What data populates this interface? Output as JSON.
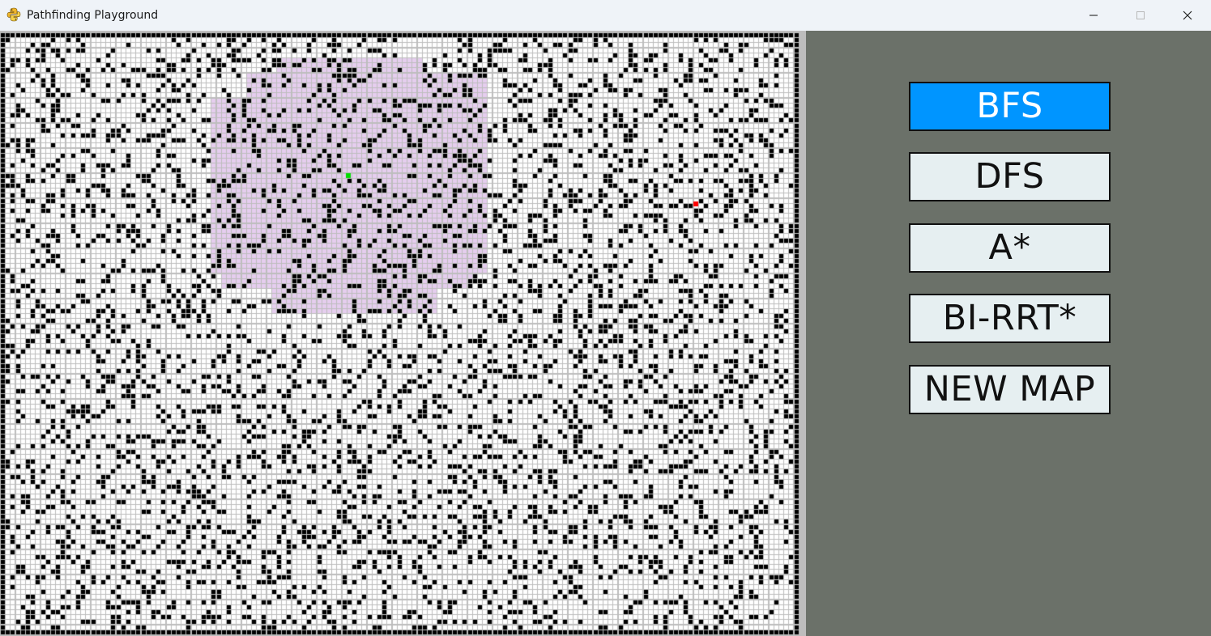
{
  "window": {
    "title": "Pathfinding Playground",
    "app_icon": "python-icon",
    "controls": [
      "minimize-icon",
      "maximize-icon",
      "close-icon"
    ]
  },
  "grid": {
    "visited_region_color": "#e6cdef",
    "start_color": "#00dd00",
    "goal_color": "#ff0000",
    "wall_color": "#000000",
    "empty_color": "#ffffff",
    "line_color": "#bdbdbd"
  },
  "panel": {
    "background": "#6b7169",
    "buttons": [
      {
        "label": "BFS",
        "active": true
      },
      {
        "label": "DFS",
        "active": false
      },
      {
        "label": "A*",
        "active": false
      },
      {
        "label": "BI-RRT*",
        "active": false
      },
      {
        "label": "NEW MAP",
        "active": false
      }
    ],
    "active_color": "#0095ff",
    "inactive_color": "#e6eff1"
  }
}
